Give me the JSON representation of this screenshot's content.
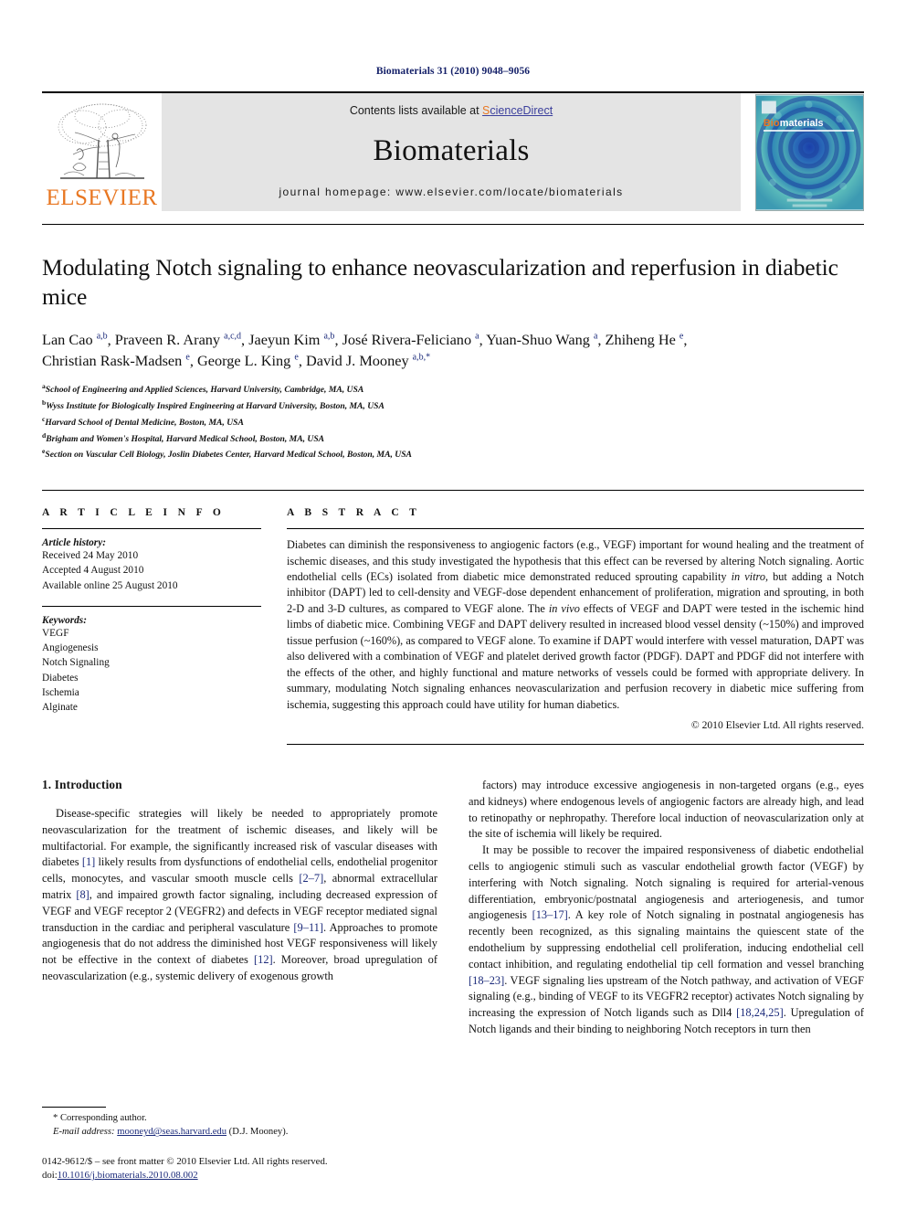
{
  "running_head": "Biomaterials 31 (2010) 9048–9056",
  "banner": {
    "publisher_name": "ELSEVIER",
    "contents_prefix": "Contents lists available at ",
    "contents_link_s": "S",
    "contents_link_rest": "cienceDirect",
    "journal_name": "Biomaterials",
    "homepage": "journal homepage: www.elsevier.com/locate/biomaterials",
    "cover_title_bio": "Bio",
    "cover_title_materials": "materials"
  },
  "article": {
    "title": "Modulating Notch signaling to enhance neovascularization and reperfusion in diabetic mice",
    "authors_line1_parts": [
      {
        "name": "Lan Cao ",
        "sup": "a,b"
      },
      {
        "name": ", Praveen R. Arany ",
        "sup": "a,c,d"
      },
      {
        "name": ", Jaeyun Kim ",
        "sup": "a,b"
      },
      {
        "name": ", José Rivera-Feliciano ",
        "sup": "a"
      },
      {
        "name": ", Yuan-Shuo Wang ",
        "sup": "a"
      },
      {
        "name": ", Zhiheng He ",
        "sup": "e"
      },
      {
        "name": ",",
        "sup": ""
      }
    ],
    "authors_line2_parts": [
      {
        "name": "Christian Rask-Madsen ",
        "sup": "e"
      },
      {
        "name": ", George L. King ",
        "sup": "e"
      },
      {
        "name": ", David J. Mooney ",
        "sup": "a,b,*"
      }
    ],
    "affiliations": [
      {
        "mark": "a",
        "text": "School of Engineering and Applied Sciences, Harvard University, Cambridge, MA, USA"
      },
      {
        "mark": "b",
        "text": "Wyss Institute for Biologically Inspired Engineering at Harvard University, Boston, MA, USA"
      },
      {
        "mark": "c",
        "text": "Harvard School of Dental Medicine, Boston, MA, USA"
      },
      {
        "mark": "d",
        "text": "Brigham and Women's Hospital, Harvard Medical School, Boston, MA, USA"
      },
      {
        "mark": "e",
        "text": "Section on Vascular Cell Biology, Joslin Diabetes Center, Harvard Medical School, Boston, MA, USA"
      }
    ]
  },
  "article_info": {
    "heading": "A R T I C L E  I N F O",
    "history_label": "Article history:",
    "history": [
      "Received 24 May 2010",
      "Accepted 4 August 2010",
      "Available online 25 August 2010"
    ],
    "keywords_label": "Keywords:",
    "keywords": [
      "VEGF",
      "Angiogenesis",
      "Notch Signaling",
      "Diabetes",
      "Ischemia",
      "Alginate"
    ]
  },
  "abstract": {
    "heading": "A B S T R A C T",
    "p1_a": "Diabetes can diminish the responsiveness to angiogenic factors (e.g., VEGF) important for wound healing and the treatment of ischemic diseases, and this study investigated the hypothesis that this effect can be reversed by altering Notch signaling. Aortic endothelial cells (ECs) isolated from diabetic mice demonstrated reduced sprouting capability ",
    "p1_i1": "in vitro",
    "p1_b": ", but adding a Notch inhibitor (DAPT) led to cell-density and VEGF-dose dependent enhancement of proliferation, migration and sprouting, in both 2-D and 3-D cultures, as compared to VEGF alone. The ",
    "p1_i2": "in vivo",
    "p1_c": " effects of VEGF and DAPT were tested in the ischemic hind limbs of diabetic mice. Combining VEGF and DAPT delivery resulted in increased blood vessel density (~150%) and improved tissue perfusion (~160%), as compared to VEGF alone. To examine if DAPT would interfere with vessel maturation, DAPT was also delivered with a combination of VEGF and platelet derived growth factor (PDGF). DAPT and PDGF did not interfere with the effects of the other, and highly functional and mature networks of vessels could be formed with appropriate delivery. In summary, modulating Notch signaling enhances neovascularization and perfusion recovery in diabetic mice suffering from ischemia, suggesting this approach could have utility for human diabetics.",
    "copyright": "© 2010 Elsevier Ltd. All rights reserved."
  },
  "introduction": {
    "section_number_title": "1.  Introduction",
    "left_p1_a": "Disease-specific strategies will likely be needed to appropriately promote neovascularization for the treatment of ischemic diseases, and likely will be multifactorial. For example, the significantly increased risk of vascular diseases with diabetes ",
    "left_ref1": "[1]",
    "left_p1_b": " likely results from dysfunctions of endothelial cells, endothelial progenitor cells, monocytes, and vascular smooth muscle cells ",
    "left_ref2": "[2–7]",
    "left_p1_c": ", abnormal extracellular matrix ",
    "left_ref3": "[8]",
    "left_p1_d": ", and impaired growth factor signaling, including decreased expression of VEGF and VEGF receptor 2 (VEGFR2) and defects in VEGF receptor mediated signal transduction in the cardiac and peripheral vasculature ",
    "left_ref4": "[9–11]",
    "left_p1_e": ". Approaches to promote angiogenesis that do not address the diminished host VEGF responsiveness will likely not be effective in the context of diabetes ",
    "left_ref5": "[12]",
    "left_p1_f": ". Moreover, broad upregulation of neovascularization (e.g., systemic delivery of exogenous growth",
    "right_p1": "factors) may introduce excessive angiogenesis in non-targeted organs (e.g., eyes and kidneys) where endogenous levels of angiogenic factors are already high, and lead to retinopathy or nephropathy. Therefore local induction of neovascularization only at the site of ischemia will likely be required.",
    "right_p2_a": "It may be possible to recover the impaired responsiveness of diabetic endothelial cells to angiogenic stimuli such as vascular endothelial growth factor (VEGF) by interfering with Notch signaling. Notch signaling is required for arterial-venous differentiation, embryonic/postnatal angiogenesis and arteriogenesis, and tumor angiogenesis ",
    "right_ref1": "[13–17]",
    "right_p2_b": ". A key role of Notch signaling in postnatal angiogenesis has recently been recognized, as this signaling maintains the quiescent state of the endothelium by suppressing endothelial cell proliferation, inducing endothelial cell contact inhibition, and regulating endothelial tip cell formation and vessel branching ",
    "right_ref2": "[18–23]",
    "right_p2_c": ". VEGF signaling lies upstream of the Notch pathway, and activation of VEGF signaling (e.g., binding of VEGF to its VEGFR2 receptor) activates Notch signaling by increasing the expression of Notch ligands such as Dll4 ",
    "right_ref3": "[18,24,25]",
    "right_p2_d": ". Upregulation of Notch ligands and their binding to neighboring Notch receptors in turn then"
  },
  "footnotes": {
    "corresponding": "* Corresponding author.",
    "email_label": "E-mail address:",
    "email": "mooneyd@seas.harvard.edu",
    "email_suffix": "(D.J. Mooney).",
    "issn_line": "0142-9612/$ – see front matter © 2010 Elsevier Ltd. All rights reserved.",
    "doi_label": "doi:",
    "doi": "10.1016/j.biomaterials.2010.08.002"
  },
  "colors": {
    "link": "#1b2a7a",
    "elsevier_orange": "#E87722",
    "running_head": "#131f68",
    "banner_grey": "#e4e4e4"
  }
}
